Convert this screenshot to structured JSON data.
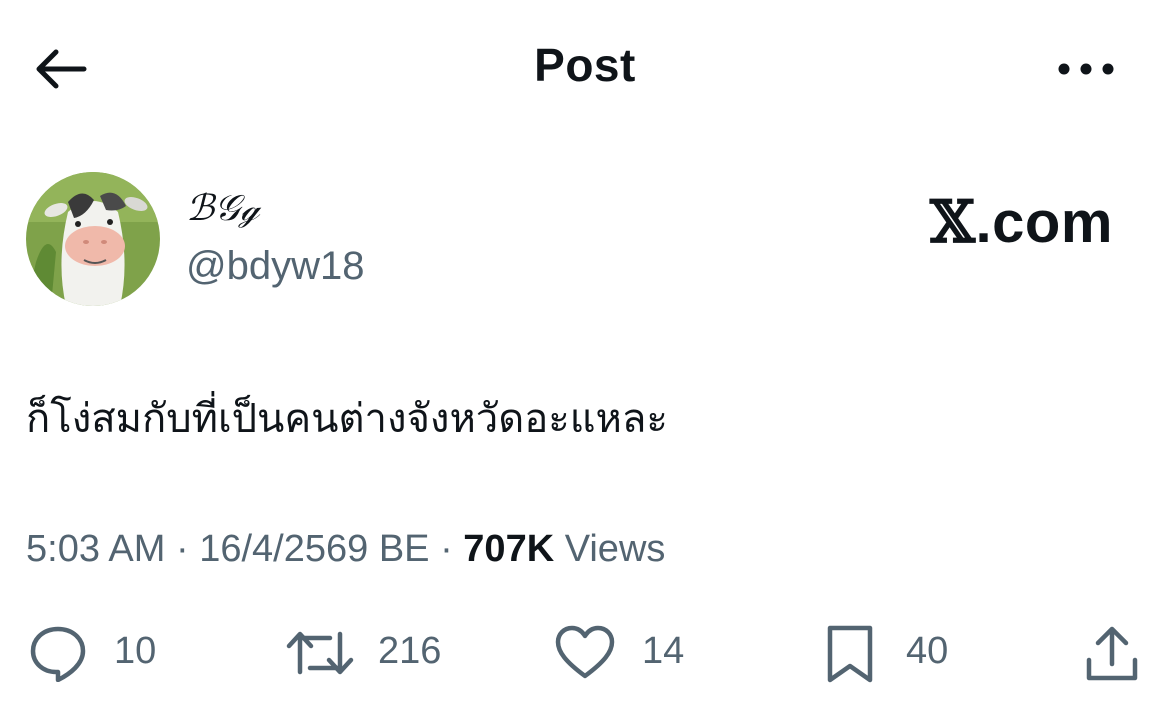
{
  "header": {
    "back_icon": "arrow-left-icon",
    "title": "Post",
    "more_icon": "ellipsis-icon"
  },
  "author": {
    "avatar_icon": "cow-face-avatar",
    "display_name": "ℬ𝒢ℊ",
    "handle": "@bdyw18"
  },
  "brand": {
    "x_glyph": "𝕏",
    "domain": ".com"
  },
  "tweet": {
    "text": "ก็โง่สมกับที่เป็นคนต่างจังหวัดอะแหละ"
  },
  "meta": {
    "time": "5:03 AM",
    "separator": "·",
    "date": "16/4/2569 BE",
    "views_count": "707K",
    "views_label": "Views"
  },
  "actions": {
    "reply": {
      "icon": "reply-bubble-icon",
      "count": "10"
    },
    "repost": {
      "icon": "repost-icon",
      "count": "216"
    },
    "like": {
      "icon": "heart-icon",
      "count": "14"
    },
    "bookmark": {
      "icon": "bookmark-icon",
      "count": "40"
    },
    "share": {
      "icon": "share-icon"
    }
  },
  "colors": {
    "text_primary": "#0f1419",
    "text_secondary": "#536471",
    "background": "#ffffff"
  }
}
